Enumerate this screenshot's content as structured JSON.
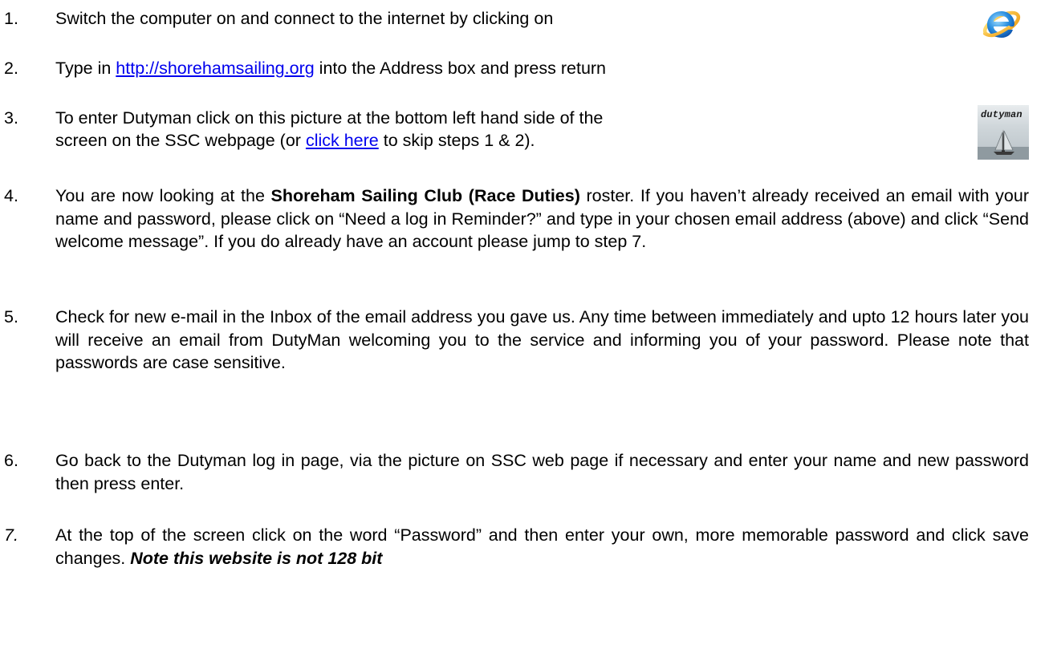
{
  "steps": [
    {
      "number": "1.",
      "text": "Switch the computer on and connect to the internet by clicking on",
      "icon": "internet-explorer-icon"
    },
    {
      "number": "2.",
      "before": "Type in ",
      "link": "http://shorehamsailing.org",
      "after": " into the Address box and press return"
    },
    {
      "number": "3.",
      "line1": "To enter Dutyman click on this picture at the bottom left hand side of the",
      "line2_before": "screen on the SSC webpage (or ",
      "link": "click here",
      "line2_after": " to skip steps 1 & 2).",
      "image_word": "dutyman"
    },
    {
      "number": "4.",
      "before": "You are now looking at the ",
      "bold": "Shoreham Sailing Club (Race Duties)",
      "after": " roster.  If you haven’t already received an email with your name and password, please click on “Need a log in Reminder?” and type in your chosen email address (above) and click “Send welcome message”. If you do already have an account please jump to step 7."
    },
    {
      "number": "5.",
      "text": "Check for new e-mail in the Inbox of the email address you gave us.  Any time between immediately and upto 12 hours later you will receive an email from DutyMan welcoming you to the service and informing you of your password. Please note that passwords are case sensitive."
    },
    {
      "number": "6.",
      "text": "Go back to the Dutyman log in page, via the picture on SSC web page if necessary and enter your name and new password then press enter."
    },
    {
      "number": "7.",
      "text": "At the top of the screen click on the word “Password” and then enter your own, more memorable password and click save changes. ",
      "emphasis": "Note this website is not 128 bit"
    }
  ]
}
